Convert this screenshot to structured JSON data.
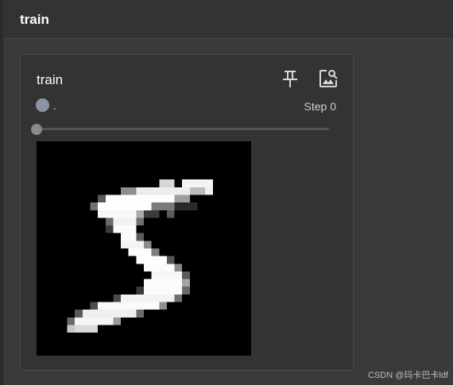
{
  "header": {
    "title": "train"
  },
  "card": {
    "title": "train",
    "legend_label": ".",
    "legend_color": "#8a94a6",
    "step_label": "Step 0",
    "slider_value": 0,
    "icons": [
      "pin-icon",
      "image-search-icon"
    ]
  },
  "watermark": "CSDN @玛卡巴卡ldf"
}
